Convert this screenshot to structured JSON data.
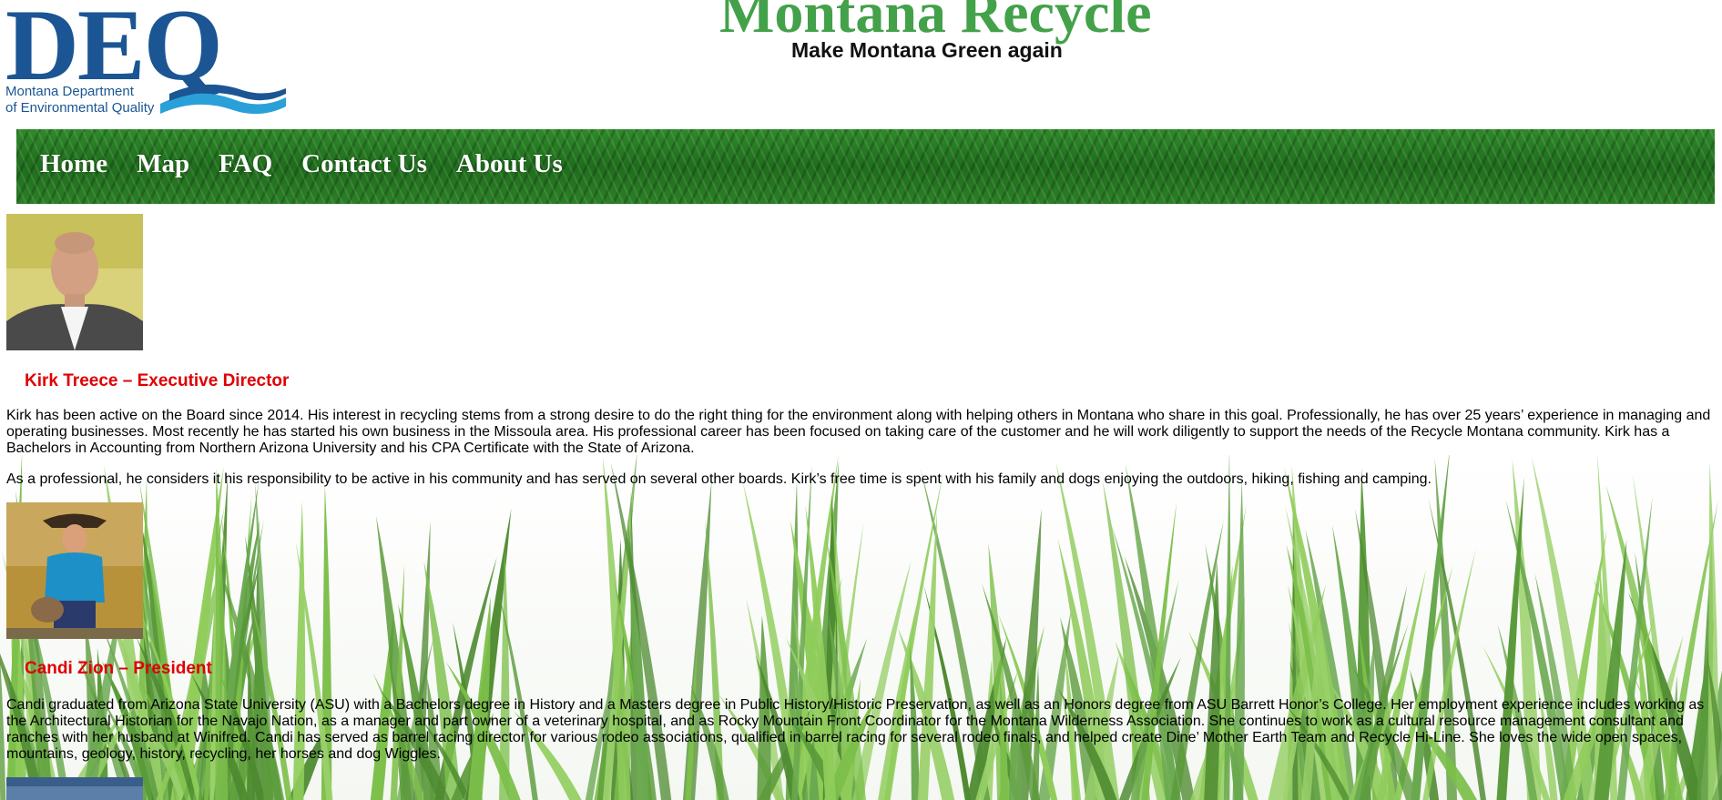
{
  "header": {
    "logo_letters": "DEQ",
    "logo_line1": "Montana Department",
    "logo_line2": "of Environmental Quality",
    "site_title": "Montana Recycle",
    "tagline": "Make Montana Green again"
  },
  "nav": {
    "items": [
      {
        "label": "Home"
      },
      {
        "label": "Map"
      },
      {
        "label": "FAQ"
      },
      {
        "label": "Contact Us"
      },
      {
        "label": "About Us"
      }
    ]
  },
  "members": [
    {
      "name": "Kirk Treece – Executive Director",
      "bio1": "Kirk has been active on the Board since 2014. His interest in recycling stems from a strong desire to do the right thing for the environment along with helping others in Montana who share in this goal. Professionally, he has over 25 years’ experience in managing and operating businesses. Most recently he has started his own business in the Missoula area. His professional career has been focused on taking care of the customer and he will work diligently to support the needs of the Recycle Montana community. Kirk has a Bachelors in Accounting from Northern Arizona University and his CPA Certificate with the State of Arizona.",
      "bio2": "As a professional, he considers it his responsibility to be active in his community and has served on several other boards. Kirk’s free time is spent with his family and dogs enjoying the outdoors, hiking, fishing and camping."
    },
    {
      "name": "Candi Zion – President",
      "bio1": "Candi graduated from Arizona State University (ASU) with a Bachelors degree in History and a Masters degree in Public History/Historic Preservation, as well as an Honors degree from ASU Barrett Honor’s College. Her employment experience includes working as the Architectural Historian for the Navajo Nation, as a manager and part owner of a veterinary hospital, and as Rocky Mountain Front Coordinator for the Montana Wilderness Association. She continues to work as a cultural resource management consultant and ranches with her husband at Winifred. Candi has served as barrel racing director for various rodeo associations, qualified in barrel racing for several rodeo finals, and helped create Dine’ Mother Earth Team and Recycle Hi-Line. She loves the wide open spaces, mountains, geology, history, recycling, her horses and dog Wiggles."
    }
  ],
  "colors": {
    "title_green": "#43a14a",
    "deq_blue": "#1b5593",
    "name_red": "#e00000"
  }
}
